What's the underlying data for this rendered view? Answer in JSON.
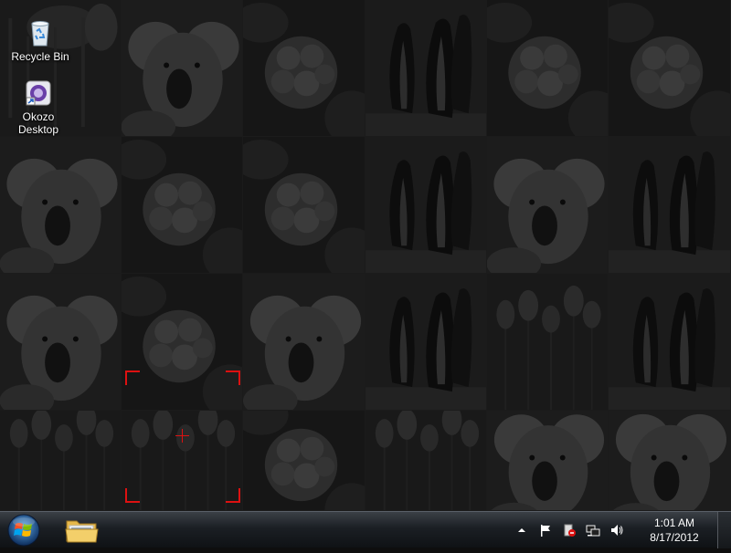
{
  "desktop": {
    "icons": [
      {
        "label": "Recycle Bin",
        "icon": "recycle-bin-icon"
      },
      {
        "label_line1": "Okozo",
        "label_line2": "Desktop",
        "icon": "okozo-desktop-icon"
      }
    ]
  },
  "grid": {
    "rows": 4,
    "columns": 6,
    "tiles": [
      "koala-left",
      "koala",
      "hydrangea",
      "penguins",
      "hydrangea",
      "hydrangea",
      "koala",
      "hydrangea",
      "hydrangea",
      "penguins",
      "koala",
      "penguins",
      "koala",
      "hydrangea",
      "koala",
      "penguins",
      "tulips",
      "penguins",
      "tulips",
      "tulips",
      "hydrangea",
      "tulips",
      "koala",
      "koala"
    ],
    "selection_color": "#d11111"
  },
  "taskbar": {
    "start_icon": "windows-orb-icon",
    "pinned": [
      {
        "name": "Windows Explorer",
        "icon": "folder-icon"
      }
    ],
    "tray_icons": [
      "show-hidden-icons-chevron",
      "action-center-flag-icon",
      "device-eject-icon",
      "network-icon",
      "volume-icon"
    ],
    "clock": {
      "time": "1:01 AM",
      "date": "8/17/2012"
    }
  }
}
